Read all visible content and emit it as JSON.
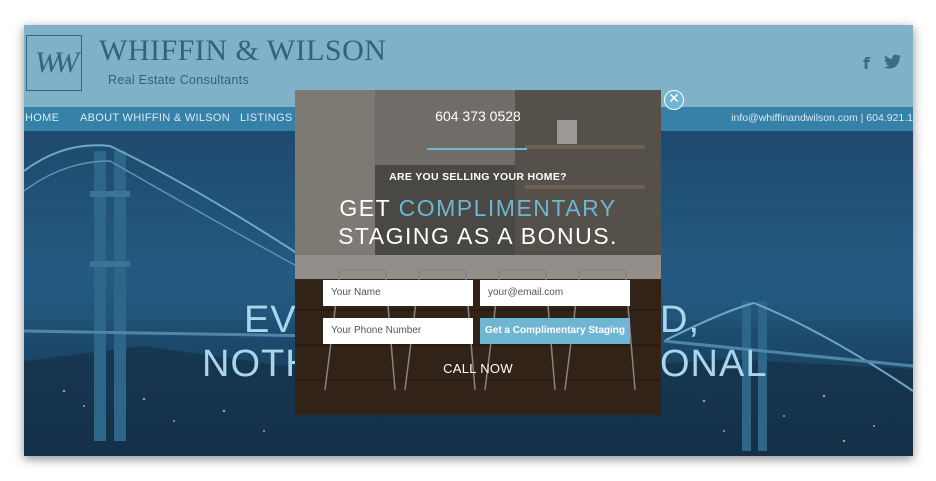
{
  "site": {
    "logo_monogram": "WW",
    "brand": "WHIFFIN & WILSON",
    "tagline": "Real Estate Consultants",
    "social": [
      {
        "icon": "facebook-icon",
        "glyph": "f"
      },
      {
        "icon": "twitter-icon",
        "glyph": "🐦"
      }
    ]
  },
  "nav": {
    "items": [
      "HOME",
      "ABOUT WHIFFIN & WILSON",
      "LISTINGS"
    ],
    "contact": "info@whiffinandwilson.com  |  604.921.1"
  },
  "hero": {
    "line1_left": "EV",
    "line1_right": "D,",
    "line2_left": "NOTH",
    "line2_right": "ONAL"
  },
  "popup": {
    "phone": "604 373 0528",
    "question": "ARE YOU SELLING YOUR HOME?",
    "headline_l1_a": "GET ",
    "headline_l1_accent": "COMPLIMENTARY",
    "headline_l2": "STAGING AS A BONUS.",
    "name_placeholder": "Your Name",
    "email_placeholder": "your@email.com",
    "phone_placeholder": "Your Phone Number",
    "cta_label": "Get a Complimentary Staging",
    "call_label": "CALL NOW",
    "close_glyph": "✕"
  },
  "colors": {
    "accent": "#6fb6d3",
    "header": "#7fb1c9",
    "nav": "#3581a8",
    "brand": "#2f6480"
  }
}
